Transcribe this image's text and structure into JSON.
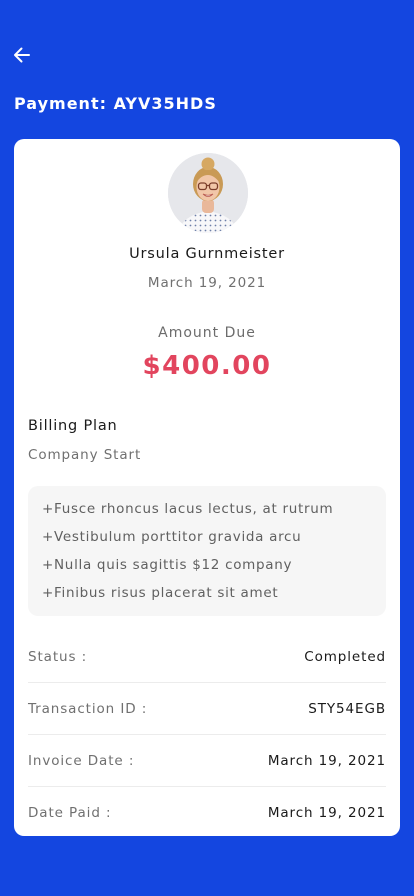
{
  "header": {
    "back_icon": "arrow-left-icon",
    "title": "Payment: AYV35HDS"
  },
  "customer": {
    "name": "Ursula Gurnmeister",
    "date": "March 19, 2021"
  },
  "amount": {
    "label": "Amount Due",
    "value": "$400.00"
  },
  "billing_plan": {
    "title": "Billing Plan",
    "name": "Company Start",
    "features": [
      "+Fusce rhoncus lacus lectus, at rutrum",
      "+Vestibulum porttitor gravida arcu",
      "+Nulla quis sagittis $12 company",
      "+Finibus risus placerat sit amet"
    ]
  },
  "details": [
    {
      "label": "Status :",
      "value": "Completed"
    },
    {
      "label": "Transaction ID :",
      "value": "STY54EGB"
    },
    {
      "label": "Invoice Date :",
      "value": "March 19, 2021"
    },
    {
      "label": "Date Paid :",
      "value": "March 19, 2021"
    }
  ],
  "colors": {
    "background": "#1446e0",
    "card": "#ffffff",
    "amount": "#e2455e",
    "feature_box": "#f6f6f6"
  }
}
